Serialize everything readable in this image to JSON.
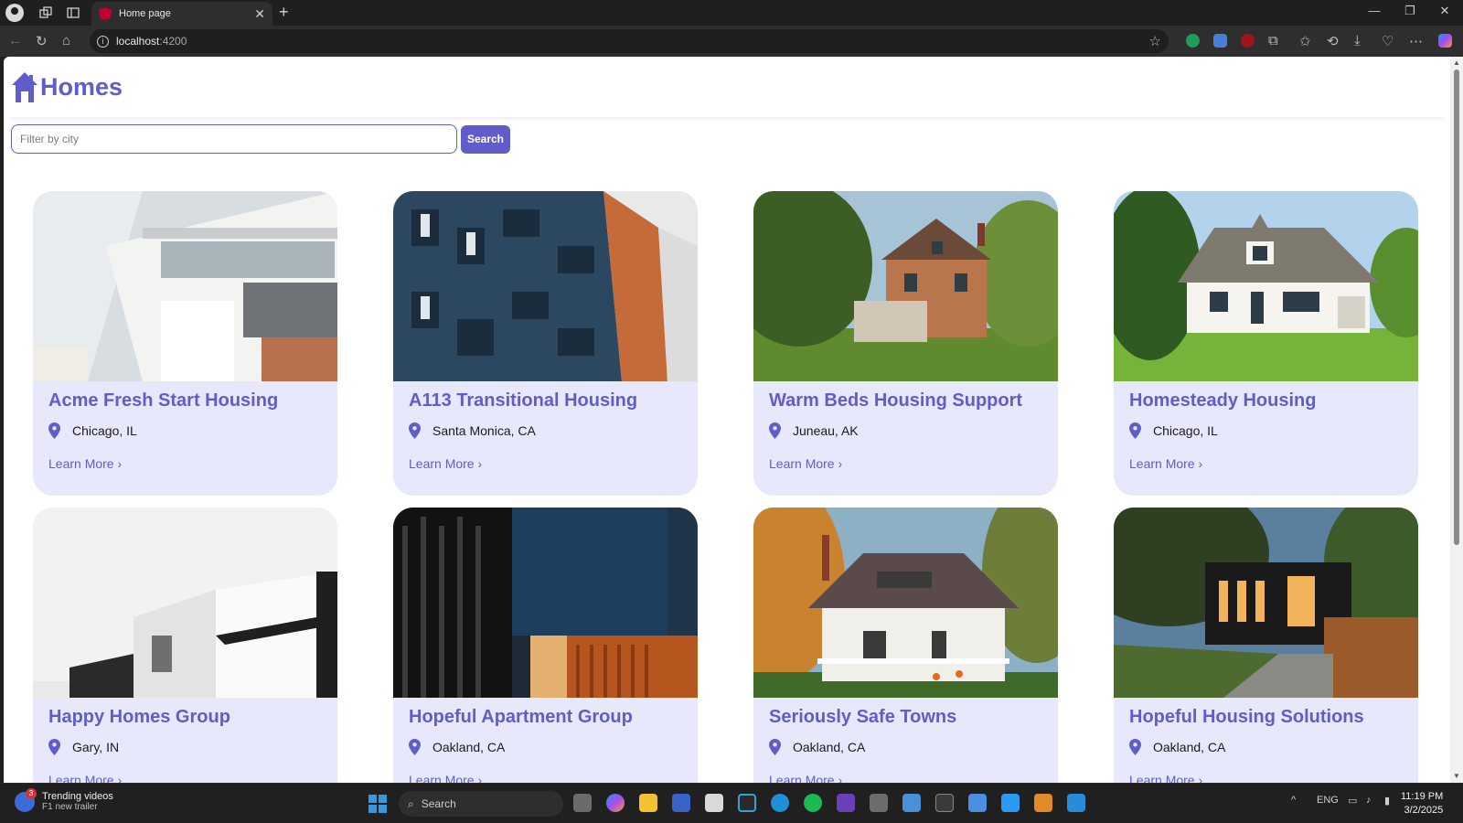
{
  "browser": {
    "tab_title": "Home page",
    "url_host": "localhost",
    "url_port": ":4200"
  },
  "app": {
    "brand": "Homes",
    "brand_color": "#605dc8"
  },
  "search": {
    "placeholder": "Filter by city",
    "value": "",
    "button_label": "Search"
  },
  "listings": [
    {
      "name": "Acme Fresh Start Housing",
      "location": "Chicago, IL",
      "link": "Learn More ›",
      "photo": "white-apartment-balconies"
    },
    {
      "name": "A113 Transitional Housing",
      "location": "Santa Monica, CA",
      "link": "Learn More ›",
      "photo": "blue-orange-apartment-block"
    },
    {
      "name": "Warm Beds Housing Support",
      "location": "Juneau, AK",
      "link": "Learn More ›",
      "photo": "victorian-house-trees"
    },
    {
      "name": "Homesteady Housing",
      "location": "Chicago, IL",
      "link": "Learn More ›",
      "photo": "white-cottage-lawn"
    },
    {
      "name": "Happy Homes Group",
      "location": "Gary, IN",
      "link": "Learn More ›",
      "photo": "modern-white-black-house"
    },
    {
      "name": "Hopeful Apartment Group",
      "location": "Oakland, CA",
      "link": "Learn More ›",
      "photo": "dark-modern-building-night"
    },
    {
      "name": "Seriously Safe Towns",
      "location": "Oakland, CA",
      "link": "Learn More ›",
      "photo": "white-house-autumn"
    },
    {
      "name": "Hopeful Housing Solutions",
      "location": "Oakland, CA",
      "link": "Learn More ›",
      "photo": "modern-house-dusk"
    }
  ],
  "taskbar": {
    "widget_badge": "3",
    "widget_title": "Trending videos",
    "widget_subtitle": "F1 new trailer",
    "search_label": "Search",
    "language": "ENG",
    "time": "11:19 PM",
    "date": "3/2/2025"
  }
}
